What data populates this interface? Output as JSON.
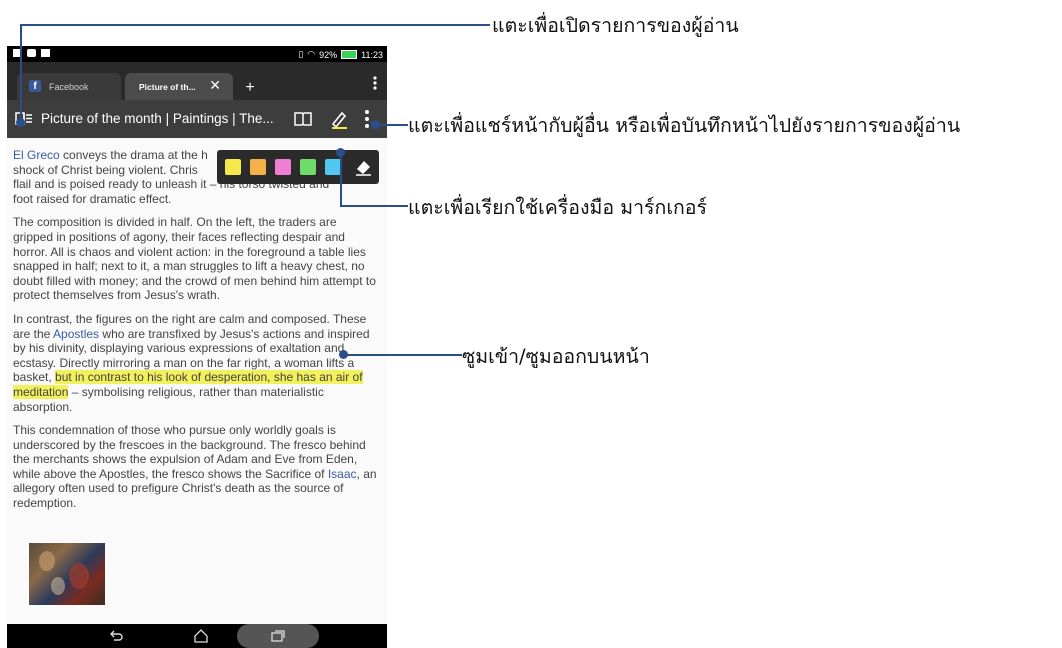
{
  "status_bar": {
    "battery": "92%",
    "time": "11:23"
  },
  "tabs": [
    {
      "label": "Facebook",
      "icon": "facebook-icon",
      "active": false
    },
    {
      "label": "Picture of th...",
      "active": true
    }
  ],
  "tab_controls": {
    "new_tab": "+",
    "close": "✕",
    "menu": "⋮"
  },
  "reader": {
    "title": "Picture of the month | Paintings | The...",
    "icons": [
      "reader-list-icon",
      "book-icon",
      "marker-pen-icon",
      "overflow-menu-icon"
    ]
  },
  "marker_palette": {
    "colors": [
      "#f5e84a",
      "#f5b14a",
      "#f07ed2",
      "#6fdc6a",
      "#50c8f0"
    ],
    "eraser": "eraser-icon"
  },
  "article": {
    "p1_link": "El Greco",
    "p1_text": " conveys the drama at the heart of this scene: the shock of Christ being violent. Christ raises his arm and flail and is poised ready to unleash it – his torso twisted and foot raised for dramatic effect.",
    "p1_visible_a": " conveys the drama at the h",
    "p1_line2": "shock of Christ being violent. Chris",
    "p1_line3": "flail and is poised ready to unleash it – his torso twisted and",
    "p1_line4": "foot raised for dramatic effect.",
    "p2": "The composition is divided in half. On the left, the traders are gripped in positions of agony, their faces reflecting despair and horror. All is chaos and violent action: in the foreground a table lies snapped in half; next to it, a man struggles to lift a heavy chest, no doubt filled with money; and the crowd of men behind him attempt to protect themselves from Jesus's wrath.",
    "p3_a": "In contrast, the figures on the right are calm and composed. These are the ",
    "p3_link": "Apostles",
    "p3_b": " who are transfixed by Jesus's actions and inspired by his divinity, displaying various expressions of exaltation and ecstasy. Directly mirroring a man on the far right, a woman lifts a basket, ",
    "p3_highlight": "but in contrast to his look of desperation, she has an air of meditation",
    "p3_c": " – symbolising religious, rather than materialistic absorption.",
    "p4_a": "This condemnation of those who pursue only worldly goals is underscored by the frescoes in the background. The fresco behind the merchants shows the expulsion of Adam and Eve from Eden, while above the Apostles, the fresco shows the Sacrifice of ",
    "p4_link": "Isaac",
    "p4_b": ", an allegory often used to prefigure Christ's death as the source of redemption."
  },
  "nav": {
    "back": "back-icon",
    "home": "home-icon",
    "recents": "recents-icon"
  },
  "annotations": {
    "open_reading_list": "แตะเพื่อเปิดรายการของผู้อ่าน",
    "share_or_save": "แตะเพื่อแชร์หน้ากับผู้อื่น หรือเพื่อบันทึกหน้าไปยังรายการของผู้อ่าน",
    "marker_tool": "แตะเพื่อเรียกใช้เครื่องมือ มาร์กเกอร์",
    "zoom": "ซูมเข้า/ซูมออกบนหน้า"
  },
  "colors": {
    "callout": "#2a4e8a",
    "highlight": "#f2f05c",
    "link": "#3a5aa8"
  }
}
